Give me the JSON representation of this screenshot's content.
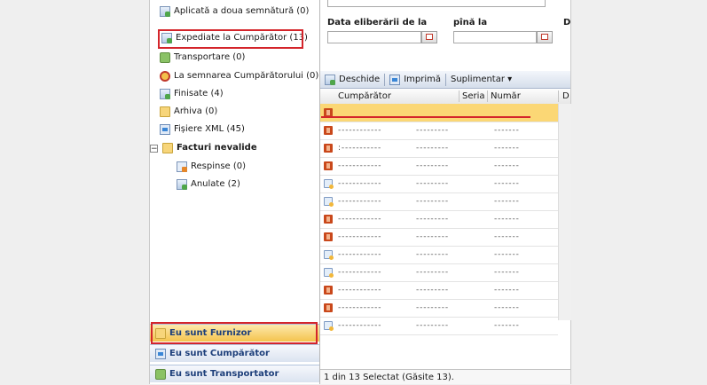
{
  "sidebar": {
    "tree": [
      {
        "label": "Aplicată a doua semnătură (0)",
        "icon": "doc-sign-icon"
      },
      {
        "label": "Expediate la Cumpărător (13)",
        "icon": "doc-sent-icon"
      },
      {
        "label": "Transportare (0)",
        "icon": "truck-icon"
      },
      {
        "label": "La semnarea Cumpărătorului (0)",
        "icon": "seal-icon"
      },
      {
        "label": "Finisate (4)",
        "icon": "doc-done-icon"
      },
      {
        "label": "Arhiva (0)",
        "icon": "folder-icon"
      },
      {
        "label": "Fișiere XML (45)",
        "icon": "xml-file-icon"
      },
      {
        "label": "Facturi nevalide",
        "icon": "folder-icon"
      },
      {
        "label": "Respinse (0)",
        "icon": "doc-rejected-icon"
      },
      {
        "label": "Anulate (2)",
        "icon": "doc-cancelled-icon"
      }
    ],
    "collapse_symbol": "−",
    "accordion": [
      {
        "label": "Eu sunt Furnizor",
        "active": true
      },
      {
        "label": "Eu sunt Cumpărător",
        "active": false
      },
      {
        "label": "Eu sunt Transportator",
        "active": false
      }
    ]
  },
  "filter": {
    "date_from_label": "Data eliberării de la",
    "date_to_label": "pînă la",
    "cut_label": "D"
  },
  "toolbar": {
    "open_label": "Deschide",
    "print_label": "Imprimă",
    "more_label": "Suplimentar ▾"
  },
  "grid": {
    "columns": [
      "Cumpărător",
      "Seria",
      "Număr",
      "D"
    ],
    "rows": [
      {
        "type": "pdf",
        "selected": true,
        "c1": "",
        "c2": "",
        "c3": ""
      },
      {
        "type": "pdf",
        "selected": false,
        "c1": "- - - - - - - - - - - -",
        "c2": "- - - - - - - - -",
        "c3": "- - - - - - -"
      },
      {
        "type": "pdf",
        "selected": false,
        "c1": ": - - - - - - - - - - -",
        "c2": "- - - - - - - - -",
        "c3": "- - - - - - -"
      },
      {
        "type": "pdf",
        "selected": false,
        "c1": "- - - - - - - - - - - -",
        "c2": "- - - - - - - - -",
        "c3": "- - - - - - -"
      },
      {
        "type": "doc",
        "selected": false,
        "c1": "- - - - - - - - - - - -",
        "c2": "- - - - - - - - -",
        "c3": "- - - - - - -"
      },
      {
        "type": "doc",
        "selected": false,
        "c1": "- - - - - - - - - - - -",
        "c2": "- - - - - - - - -",
        "c3": "- - - - - - -"
      },
      {
        "type": "pdf",
        "selected": false,
        "c1": "- - - - - - - - - - - -",
        "c2": "- - - - - - - - -",
        "c3": "- - - - - - -"
      },
      {
        "type": "pdf",
        "selected": false,
        "c1": "- - - - - - - - - - - -",
        "c2": "- - - - - - - - -",
        "c3": "- - - - - - -"
      },
      {
        "type": "doc",
        "selected": false,
        "c1": "- - - - - - - - - - - -",
        "c2": "- - - - - - - - -",
        "c3": "- - - - - - -"
      },
      {
        "type": "doc",
        "selected": false,
        "c1": "- - - - - - - - - - - -",
        "c2": "- - - - - - - - -",
        "c3": "- - - - - - -"
      },
      {
        "type": "pdf",
        "selected": false,
        "c1": "- - - - - - - - - - - -",
        "c2": "- - - - - - - - -",
        "c3": "- - - - - - -"
      },
      {
        "type": "pdf",
        "selected": false,
        "c1": "- - - - - - - - - - - -",
        "c2": "- - - - - - - - -",
        "c3": "- - - - - - -"
      },
      {
        "type": "doc",
        "selected": false,
        "c1": "- - - - - - - - - - - -",
        "c2": "- - - - - - - - -",
        "c3": "- - - - - - -"
      }
    ]
  },
  "status": {
    "text": "1 din 13 Selectat (Găsite 13)."
  },
  "colors": {
    "highlight": "#d4252b",
    "selected_row": "#fbd775",
    "accordion_active": "#f4c34d"
  }
}
